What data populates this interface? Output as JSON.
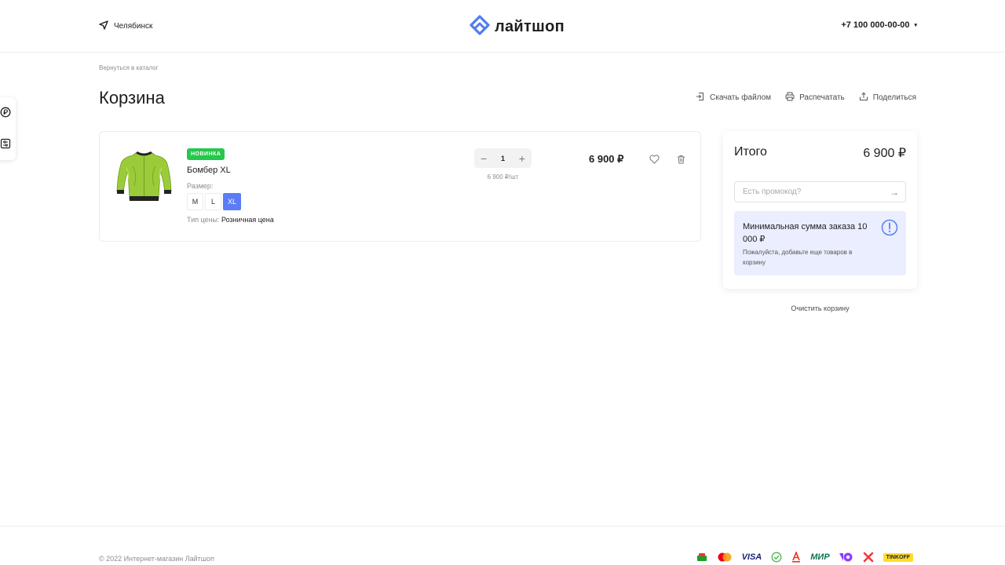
{
  "header": {
    "city": "Челябинск",
    "logo_text": "лайтшоп",
    "phone": "+7 100 000-00-00",
    "phone_caret": "▾"
  },
  "breadcrumb": "Вернуться в каталог",
  "page_title": "Корзина",
  "actions": {
    "download": "Скачать файлом",
    "print": "Распечатать",
    "share": "Поделиться"
  },
  "cart_item": {
    "badge": "НОВИНКА",
    "name": "Бомбер XL",
    "size_label": "Размер:",
    "sizes": [
      "M",
      "L",
      "XL"
    ],
    "selected_size": "XL",
    "price_type_label": "Тип цены:",
    "price_type_value": "Розничная цена",
    "quantity": "1",
    "minus": "−",
    "plus": "+",
    "unit_price": "6 900 ₽/шт",
    "total_price": "6 900 ₽"
  },
  "summary": {
    "label": "Итого",
    "total": "6 900 ₽",
    "promo_placeholder": "Есть промокод?",
    "promo_arrow": "→",
    "notice_title": "Минимальная сумма заказа 10 000 ₽",
    "notice_text": "Пожалуйста, добавьте еще товаров в корзину"
  },
  "clear_cart": "Очистить корзину",
  "footer": {
    "copyright": "© 2022 Интернет-магазин Лайтшоп",
    "payments": [
      "VISA",
      "МИР",
      "TINKOFF"
    ]
  },
  "colors": {
    "accent": "#5b7cf6",
    "badge": "#26c74d",
    "notice_bg": "#eaeefe",
    "logo": "#4f7df0"
  }
}
